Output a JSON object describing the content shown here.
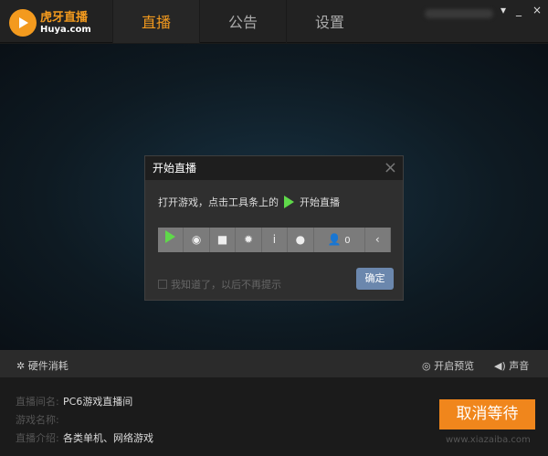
{
  "logo": {
    "cn": "虎牙直播",
    "en": "Huya.com"
  },
  "tabs": [
    {
      "label": "直播",
      "active": true
    },
    {
      "label": "公告"
    },
    {
      "label": "设置"
    }
  ],
  "window": {
    "menu": "▾",
    "min": "_",
    "close": "×"
  },
  "dialog": {
    "title": "开始直播",
    "close": "×",
    "instruction": "打开游戏，点击工具条上的",
    "instruction_action": "开始直播",
    "viewer_count": "0",
    "checkbox_label": "我知道了，以后不再提示",
    "ok": "确定"
  },
  "bottom_bar": {
    "hardware": "硬件消耗",
    "preview": "开启预览",
    "sound": "声音"
  },
  "info": [
    {
      "k": "直播间名:",
      "v": "PC6游戏直播间"
    },
    {
      "k": "游戏名称:",
      "v": ""
    },
    {
      "k": "直播介绍:",
      "v": "各类单机、网络游戏"
    }
  ],
  "cancel": "取消等待",
  "watermark": "www.xiazaiba.com",
  "colors": {
    "accent": "#f39a1e",
    "play": "#5fd94a",
    "ok": "#6b87ad"
  }
}
